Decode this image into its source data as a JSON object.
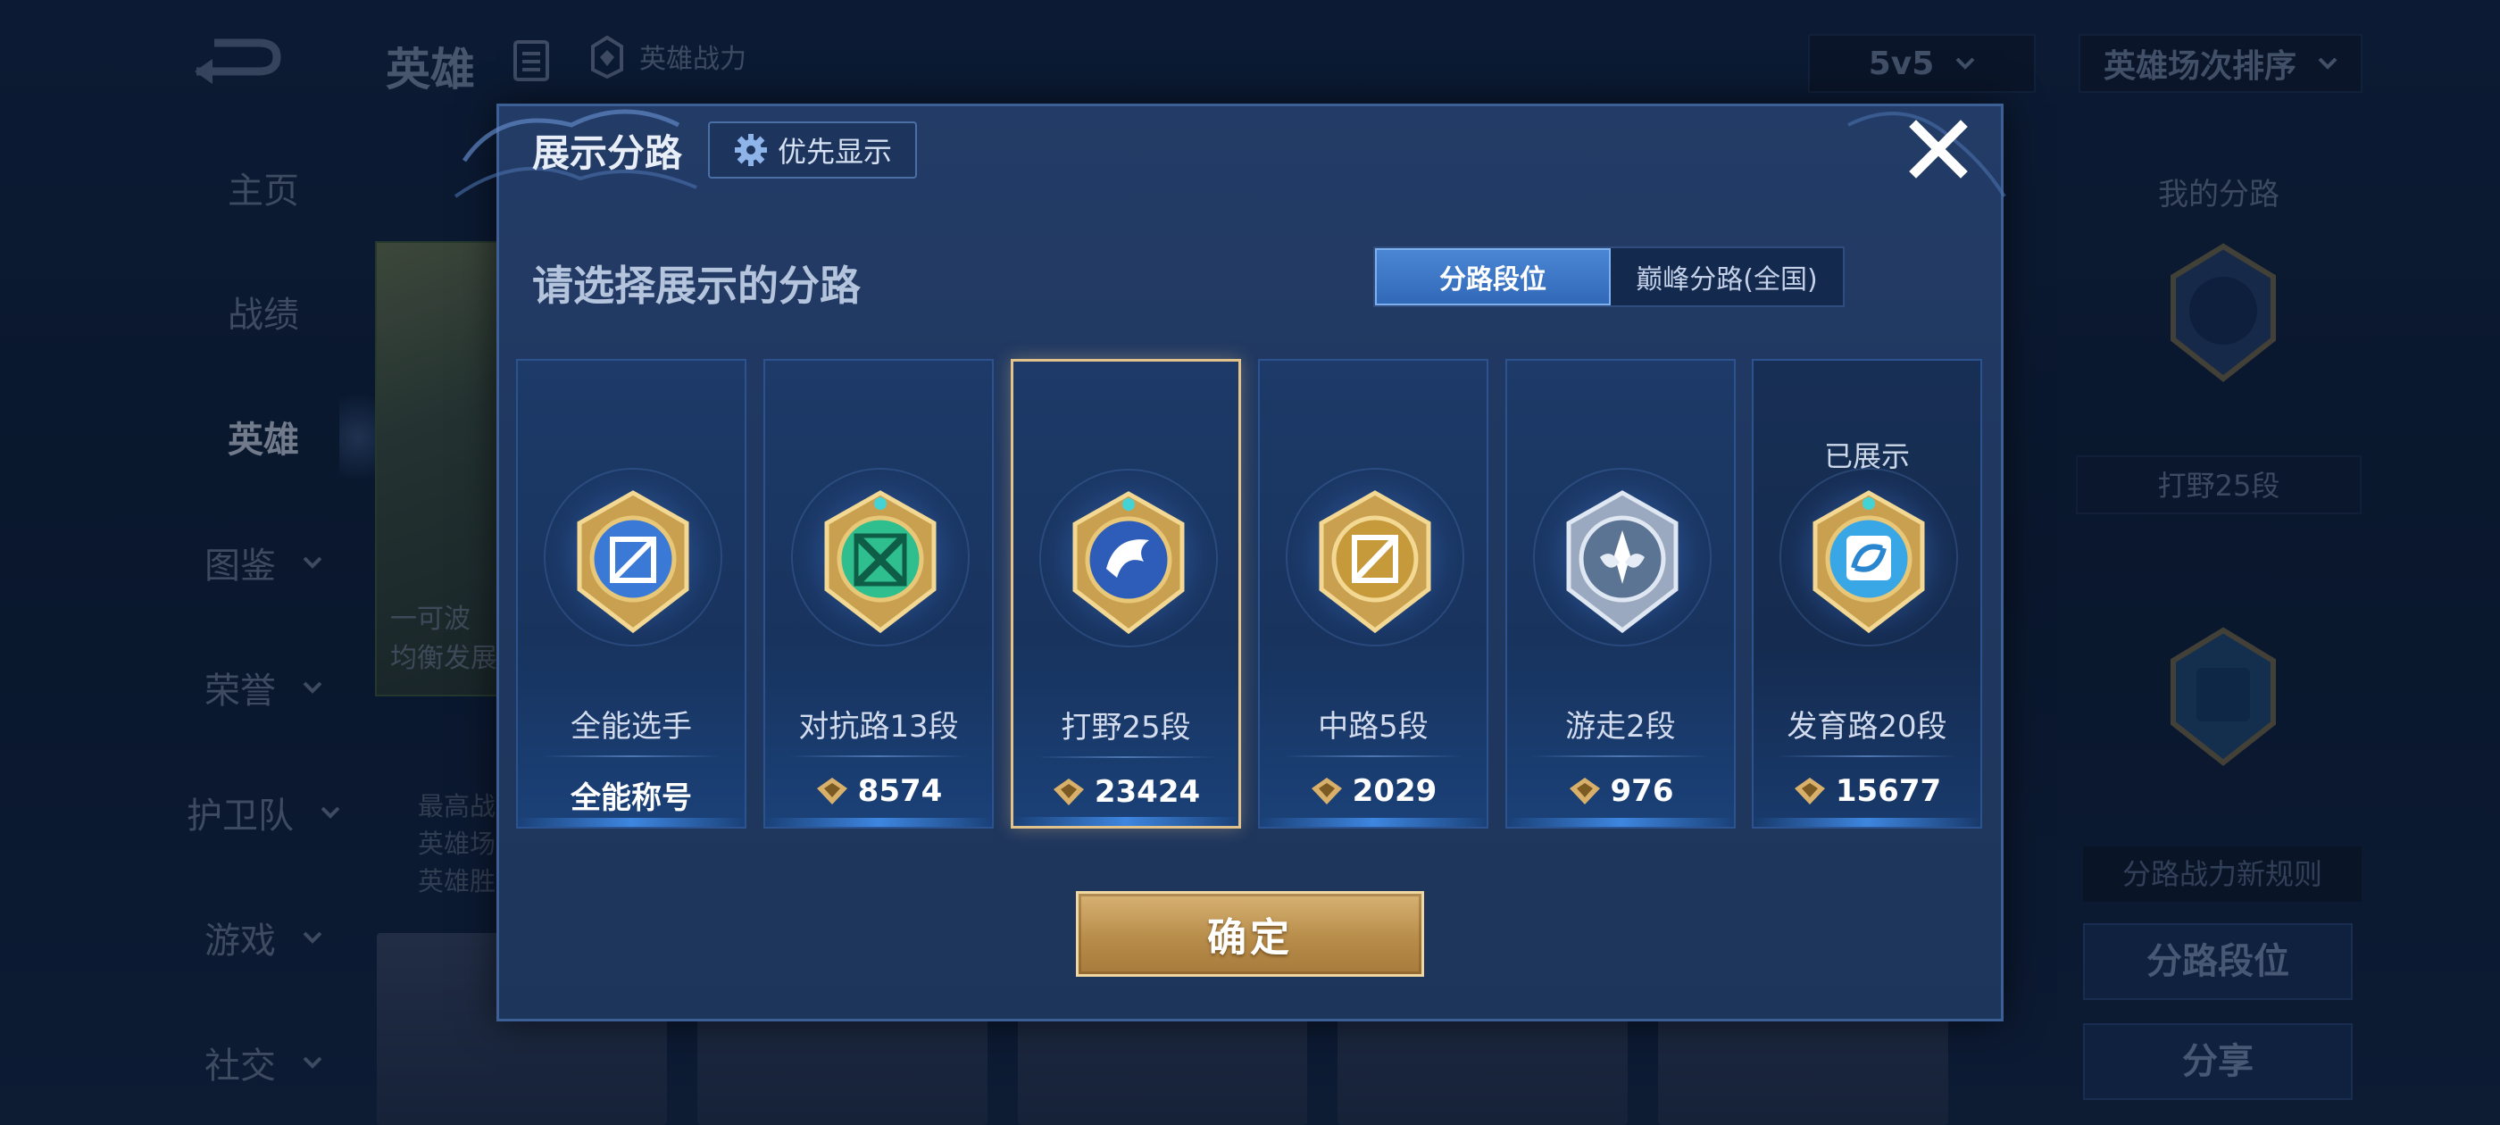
{
  "background": {
    "title": "英雄",
    "power_label": "英雄战力",
    "mode_select": "5v5",
    "sort_select": "英雄场次排序",
    "nav": [
      {
        "label": "主页",
        "has_arrow": false,
        "active": false
      },
      {
        "label": "战绩",
        "has_arrow": false,
        "active": false
      },
      {
        "label": "英雄",
        "has_arrow": false,
        "active": true
      },
      {
        "label": "图鉴",
        "has_arrow": true,
        "active": false
      },
      {
        "label": "荣誉",
        "has_arrow": true,
        "active": false
      },
      {
        "label": "护卫队",
        "has_arrow": true,
        "active": false
      },
      {
        "label": "游戏",
        "has_arrow": true,
        "active": false
      },
      {
        "label": "社交",
        "has_arrow": true,
        "active": false
      }
    ],
    "hero_card_text_1": "一可波",
    "hero_card_text_2": "均衡发展",
    "stat_lines": [
      "最高战",
      "英雄场",
      "英雄胜"
    ],
    "right": {
      "my_lane_title": "我的分路",
      "lane_badge_label": "打野25段",
      "rule_text": "分路战力新规则",
      "lane_rank_button": "分路段位",
      "share_button": "分享"
    }
  },
  "modal": {
    "title": "展示分路",
    "priority_button": "优先显示",
    "subtitle": "请选择展示的分路",
    "toggle": [
      {
        "label": "分路段位",
        "active": true
      },
      {
        "label": "巅峰分路(全国)",
        "active": false
      }
    ],
    "cards": [
      {
        "label": "全能选手",
        "value": "全能称号",
        "show_power_icon": false,
        "selected": false,
        "shown_tag": "",
        "badge": "all-round-badge",
        "color": "#3a7ad6"
      },
      {
        "label": "对抗路13段",
        "value": "8574",
        "show_power_icon": true,
        "selected": false,
        "shown_tag": "",
        "badge": "clash-lane-badge",
        "color": "#2fbf8e"
      },
      {
        "label": "打野25段",
        "value": "23424",
        "show_power_icon": true,
        "selected": true,
        "shown_tag": "",
        "badge": "jungle-badge",
        "color": "#2d5db8"
      },
      {
        "label": "中路5段",
        "value": "2029",
        "show_power_icon": true,
        "selected": false,
        "shown_tag": "",
        "badge": "mid-lane-badge",
        "color": "#c69a3a"
      },
      {
        "label": "游走2段",
        "value": "976",
        "show_power_icon": true,
        "selected": false,
        "shown_tag": "",
        "badge": "roam-badge",
        "color": "#8ea3bf"
      },
      {
        "label": "发育路20段",
        "value": "15677",
        "show_power_icon": true,
        "selected": false,
        "shown_tag": "已展示",
        "badge": "farm-lane-badge",
        "color": "#39a6e6"
      }
    ],
    "confirm_button": "确定"
  },
  "colors": {
    "gold": "#e2c28b",
    "accent_blue": "#3169b8",
    "panel": "#203860"
  }
}
